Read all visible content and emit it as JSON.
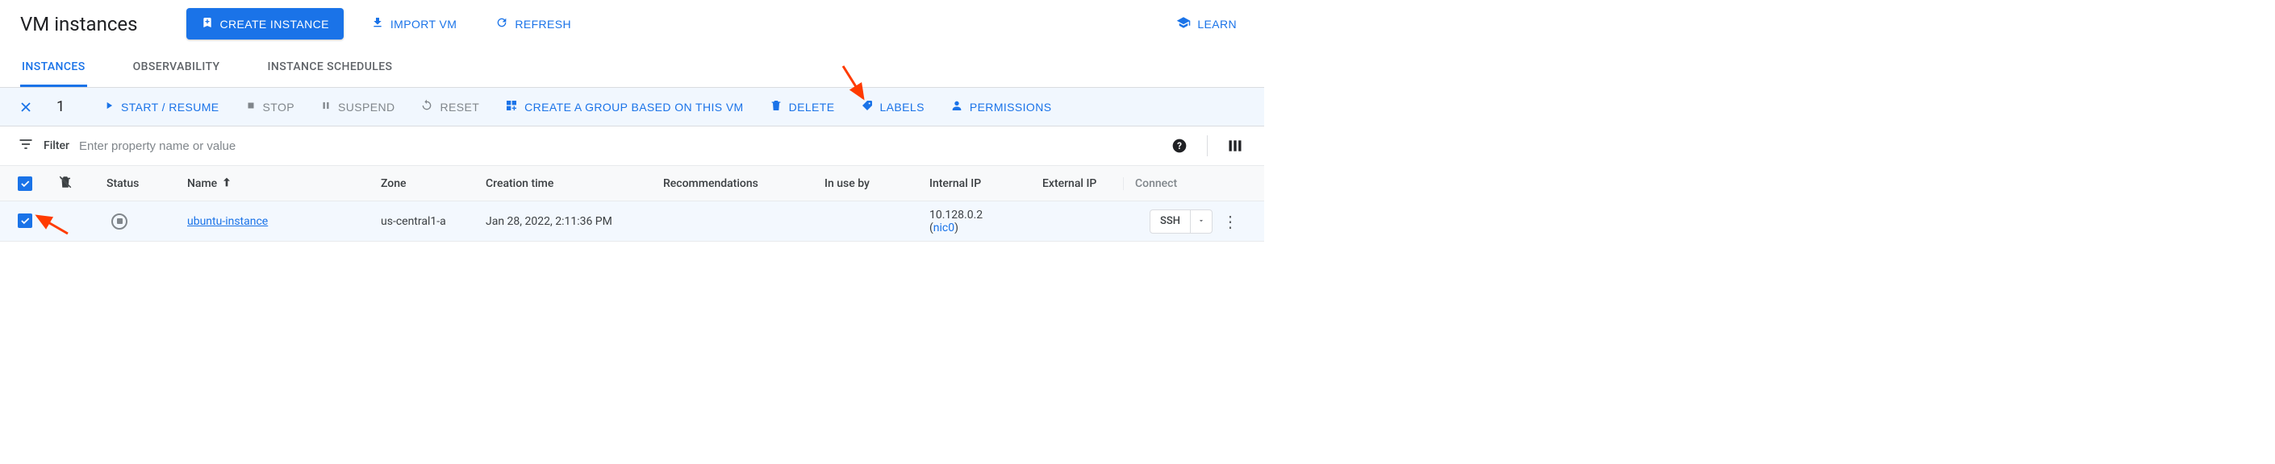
{
  "header": {
    "title": "VM instances",
    "create_btn": "CREATE INSTANCE",
    "import_btn": "IMPORT VM",
    "refresh_btn": "REFRESH",
    "learn_btn": "LEARN"
  },
  "tabs": {
    "instances": "INSTANCES",
    "observability": "OBSERVABILITY",
    "schedules": "INSTANCE SCHEDULES"
  },
  "selection": {
    "count": "1",
    "start": "START / RESUME",
    "stop": "STOP",
    "suspend": "SUSPEND",
    "reset": "RESET",
    "group": "CREATE A GROUP BASED ON THIS VM",
    "delete": "DELETE",
    "labels": "LABELS",
    "permissions": "PERMISSIONS"
  },
  "filter": {
    "label": "Filter",
    "placeholder": "Enter property name or value"
  },
  "columns": {
    "status": "Status",
    "name": "Name",
    "zone": "Zone",
    "creation": "Creation time",
    "recommendations": "Recommendations",
    "inuse": "In use by",
    "internal": "Internal IP",
    "external": "External IP",
    "connect": "Connect"
  },
  "row": {
    "name": "ubuntu-instance",
    "zone": "us-central1-a",
    "created": "Jan 28, 2022, 2:11:36 PM",
    "internal_ip": "10.128.0.2",
    "nic": "nic0",
    "ssh": "SSH"
  }
}
